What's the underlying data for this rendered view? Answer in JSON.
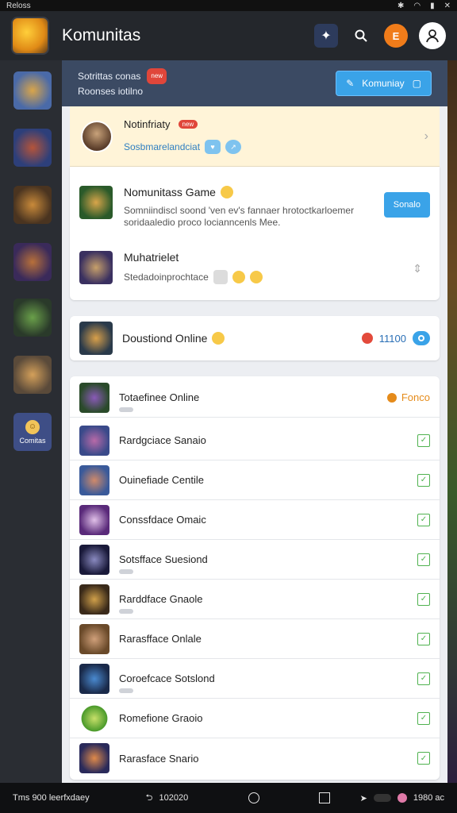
{
  "status_bar": {
    "left": "Reloss",
    "right_icons": [
      "bluetooth-icon",
      "wifi-icon",
      "battery-icon",
      "close-icon"
    ]
  },
  "app": {
    "title": "Komunitas"
  },
  "header_icons": {
    "orange_badge": "E"
  },
  "rail": {
    "items": [
      "game-1",
      "game-2",
      "game-3",
      "game-4",
      "game-5",
      "game-6"
    ],
    "community_label": "Comitas"
  },
  "hero": {
    "line1": "Sotrittas conas",
    "badge": "new",
    "line2": "Roonses iotilno",
    "button_label": "Komuniay"
  },
  "notification": {
    "name": "Notinfriaty",
    "badge": "new",
    "sub": "Sosbmarelandciat"
  },
  "featured": {
    "title": "Nomunitass Game",
    "desc_line1": "Somniindiscl soond 'ven ev's fannaer hrotoctkarloemer",
    "desc_line2": "soridaaledio proco locianncenls Mee.",
    "join_label": "Sonalo",
    "second_title": "Muhatrielet",
    "second_sub": "Stedadoinprochtace"
  },
  "online_card": {
    "title": "Doustiond Online",
    "status": "11100"
  },
  "list": {
    "items": [
      {
        "label": "Totaefinee Online",
        "status": "Fonco",
        "type": "online"
      },
      {
        "label": "Rardgciace Sanaio",
        "type": "check"
      },
      {
        "label": "Ouinefiade Centile",
        "type": "check"
      },
      {
        "label": "Conssfdace Omaic",
        "type": "check"
      },
      {
        "label": "Sotsfface Suesiond",
        "type": "check"
      },
      {
        "label": "Rarddface Gnaole",
        "type": "check"
      },
      {
        "label": "Rarasfface Onlale",
        "type": "check"
      },
      {
        "label": "Coroefcace Sotslond",
        "type": "check"
      },
      {
        "label": "Romefione Graoio",
        "type": "check"
      },
      {
        "label": "Rarasface Snario",
        "type": "check"
      }
    ]
  },
  "nav_bar": {
    "left": "Tms 900 leerfxdaey",
    "back": "102020",
    "right": "1980 ac"
  }
}
